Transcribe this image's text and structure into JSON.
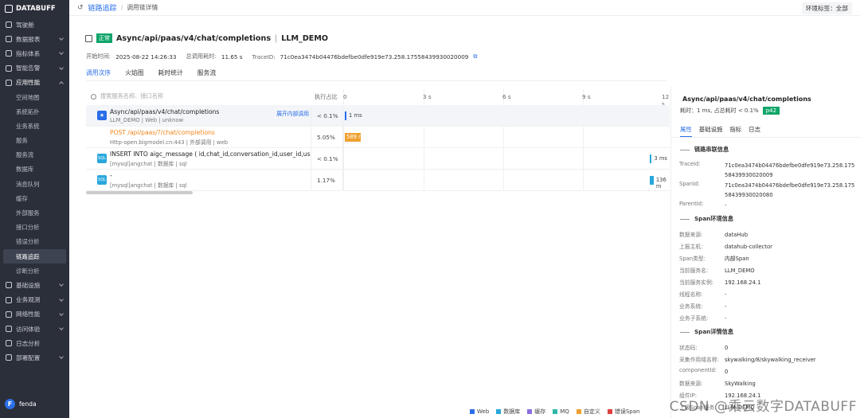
{
  "app": {
    "logo": "DATABUFF"
  },
  "sidebar": {
    "items": [
      {
        "label": "驾驶舱"
      },
      {
        "label": "数据报表"
      },
      {
        "label": "指标体系"
      },
      {
        "label": "智能告警"
      },
      {
        "label": "应用性能"
      }
    ],
    "sub_items": [
      {
        "label": "空间地图"
      },
      {
        "label": "系统拓扑"
      },
      {
        "label": "业务系统"
      },
      {
        "label": "服务"
      },
      {
        "label": "服务流"
      },
      {
        "label": "数据库"
      },
      {
        "label": "消息队列"
      },
      {
        "label": "缓存"
      },
      {
        "label": "外部服务"
      },
      {
        "label": "接口分析"
      },
      {
        "label": "错误分析"
      },
      {
        "label": "链路追踪"
      },
      {
        "label": "诊断分析"
      }
    ],
    "items2": [
      {
        "label": "基础设施"
      },
      {
        "label": "业务观测"
      },
      {
        "label": "网络性能"
      },
      {
        "label": "访问体验"
      },
      {
        "label": "日志分析"
      },
      {
        "label": "部署配置"
      }
    ],
    "user": {
      "initial": "F",
      "name": "fenda"
    }
  },
  "header": {
    "breadcrumb": "链路追踪",
    "breadcrumb2": "调用链详情",
    "env_label": "环境标签：全部"
  },
  "trace": {
    "status": "正常",
    "title": "Async/api/paas/v4/chat/completions",
    "service": "LLM_DEMO",
    "start_label": "开始时间:",
    "start": "2025-08-22 14:26:33",
    "total_label": "总调用耗时:",
    "total": "11.65 s",
    "traceid_label": "TraceID:",
    "traceid": "71c0ea3474b04476bdefbe0dfe919e73.258.17558439930020009"
  },
  "tabs": [
    "调用次序",
    "火焰图",
    "耗时统计",
    "服务流"
  ],
  "table": {
    "search_placeholder": "搜索服务名称、接口名称",
    "pct_header": "执行占比",
    "ticks": [
      "0",
      "3 s",
      "6 s",
      "9 s",
      "12 s"
    ],
    "expand_label": "展开内部调用",
    "rows": [
      {
        "title": "Async/api/paas/v4/chat/completions",
        "sub": "LLM_DEMO  |  Web  |  unknow",
        "pct": "< 0.1%",
        "dur": "1 ms",
        "start_s": 0,
        "dur_s": 0.001
      },
      {
        "title": "POST /api/paas/?/chat/completions",
        "sub": "Http-open.bigmodel.cn:443  |  外部调用  |  web",
        "pct": "5.05%",
        "dur": "589 ms",
        "start_s": 0,
        "dur_s": 0.589
      },
      {
        "title": "INSERT INTO aigc_message ( id,chat_id,conversation_id,user_id,user",
        "sub": "[mysql]angchat  |  数据库  |  sql",
        "pct": "< 0.1%",
        "dur": "3 ms",
        "start_s": 11.5,
        "dur_s": 0.003
      },
      {
        "title": "-",
        "sub": "[mysql]angchat  |  数据库  |  sql",
        "pct": "1.17%",
        "dur": "136 m",
        "start_s": 11.5,
        "dur_s": 0.136
      }
    ]
  },
  "detail": {
    "title": "Async/api/paas/v4/chat/completions",
    "meta": "耗时：1 ms, 占总耗时 < 0.1%",
    "badge": "p42",
    "tabs": [
      "属性",
      "基础设施",
      "指标",
      "日志"
    ],
    "sections": [
      "链路串联信息",
      "Span环境信息",
      "Span详情信息"
    ],
    "trace_kv": [
      {
        "k": "TraceId:",
        "v": "71c0ea3474b04476bdefbe0dfe919e73.258.17558439930020009"
      },
      {
        "k": "SpanId:",
        "v": "71c0ea3474b04476bdefbe0dfe919e73.258.17558439930020080"
      },
      {
        "k": "ParentId:",
        "v": "-"
      }
    ],
    "env_kv": [
      {
        "k": "数据来源:",
        "v": "dataHub"
      },
      {
        "k": "上报主机:",
        "v": "datahub-collector"
      },
      {
        "k": "Span类型:",
        "v": "内部Span"
      },
      {
        "k": "当前服务名:",
        "v": "LLM_DEMO"
      },
      {
        "k": "当前服务实例:",
        "v": "192.168.24.1"
      },
      {
        "k": "线程名称:",
        "v": "-"
      },
      {
        "k": "业务系统:",
        "v": "-"
      },
      {
        "k": "业务子系统:",
        "v": "-"
      }
    ],
    "span_kv": [
      {
        "k": "状态码:",
        "v": "0"
      },
      {
        "k": "采集作用域名称:",
        "v": "skywalking/8/skywalking_receiver"
      },
      {
        "k": "componentId:",
        "v": "0"
      },
      {
        "k": "数据来源:",
        "v": "SkyWalking"
      },
      {
        "k": "组件IP:",
        "v": "192.168.24.1"
      },
      {
        "k": "上级Span服务:",
        "v": "LLM_DEMO"
      }
    ]
  },
  "legend": [
    {
      "label": "Web",
      "color": "#2a6ee8"
    },
    {
      "label": "数据库",
      "color": "#29a8dc"
    },
    {
      "label": "缓存",
      "color": "#8a6fe0"
    },
    {
      "label": "MQ",
      "color": "#30b8a8"
    },
    {
      "label": "自定义",
      "color": "#f0a030"
    },
    {
      "label": "错误Span",
      "color": "#e04040"
    }
  ],
  "watermark": "CSDN @乘云数字DATABUFF"
}
